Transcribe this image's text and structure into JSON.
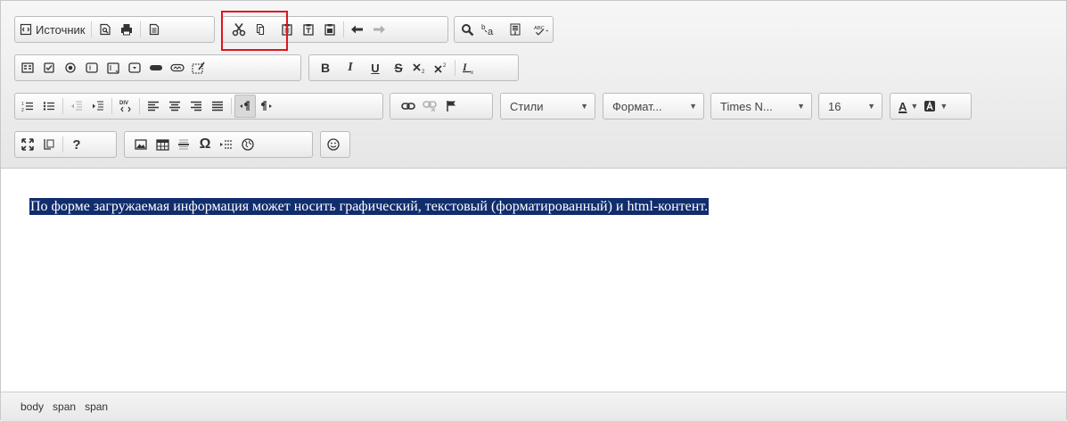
{
  "toolbar": {
    "source_label": "Источник",
    "styles_label": "Стили",
    "format_label": "Формат...",
    "font_label": "Times N...",
    "size_label": "16",
    "bold_label": "B",
    "italic_label": "I",
    "underline_label": "U",
    "strike_label": "S",
    "help_label": "?",
    "omega_label": "Ω",
    "div_label": "DIV",
    "text_color_label": "A",
    "spellcheck_label": "ABC"
  },
  "content": {
    "text": "По форме загружаемая информация может носить графический, текстовый (форматированный) и html-контент."
  },
  "statusbar": {
    "path": [
      "body",
      "span",
      "span"
    ]
  },
  "colors": {
    "selection_bg": "#112d6d",
    "highlight_border": "#e0141e"
  }
}
